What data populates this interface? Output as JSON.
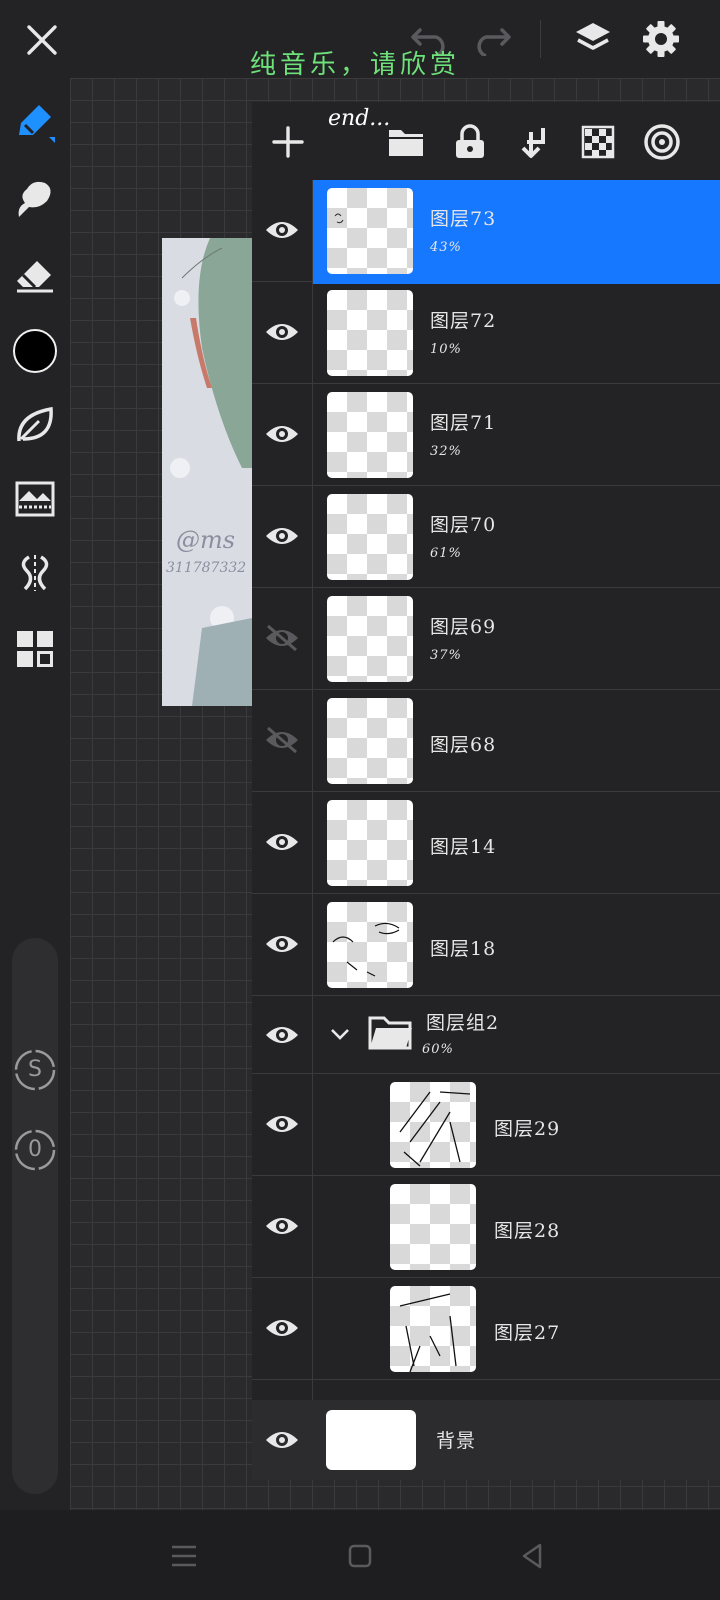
{
  "overlay": {
    "title": "纯音乐，请欣赏",
    "end": "end..."
  },
  "canvas_art": {
    "signature": "@ms",
    "number": "311787332"
  },
  "layers": [
    {
      "name": "图层73",
      "opacity": "43%",
      "visible": true,
      "selected": true
    },
    {
      "name": "图层72",
      "opacity": "10%",
      "visible": true
    },
    {
      "name": "图层71",
      "opacity": "32%",
      "visible": true
    },
    {
      "name": "图层70",
      "opacity": "61%",
      "visible": true
    },
    {
      "name": "图层69",
      "opacity": "37%",
      "visible": false
    },
    {
      "name": "图层68",
      "opacity": "",
      "visible": false
    },
    {
      "name": "图层14",
      "opacity": "",
      "visible": true
    },
    {
      "name": "图层18",
      "opacity": "",
      "visible": true
    }
  ],
  "group": {
    "name": "图层组2",
    "opacity": "60%",
    "visible": true
  },
  "group_layers": [
    {
      "name": "图层29",
      "visible": true
    },
    {
      "name": "图层28",
      "visible": true
    },
    {
      "name": "图层27",
      "visible": true
    }
  ],
  "background_layer": {
    "name": "背景",
    "visible": true
  },
  "side_buttons": {
    "s": "S",
    "zero": "0"
  },
  "colors": {
    "accent": "#1677ff",
    "current_color": "#000000",
    "overlay_text": "#6ee27a"
  },
  "icons": {
    "top": [
      "close-icon",
      "undo-icon",
      "redo-icon",
      "layers-icon",
      "settings-icon"
    ],
    "tools": [
      "pen-icon",
      "smudge-icon",
      "eraser-icon",
      "color-swatch",
      "leaf-icon",
      "filter-icon",
      "symmetry-icon",
      "grid-icon"
    ],
    "layer_toolbar": [
      "add-layer-icon",
      "folder-icon",
      "lock-icon",
      "merge-down-icon",
      "transparency-icon",
      "blend-icon"
    ]
  }
}
